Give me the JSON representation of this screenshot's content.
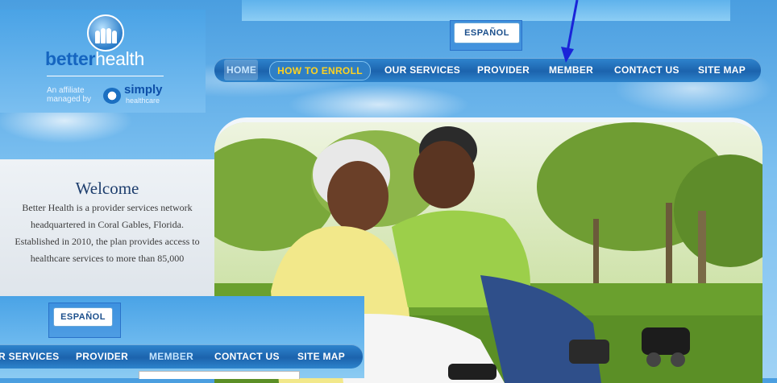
{
  "logo": {
    "brand_strong": "better",
    "brand_light": "health",
    "affiliate_line1": "An affiliate",
    "affiliate_line2": "managed by",
    "partner_name": "simply",
    "partner_sub": "healthcare"
  },
  "language_button": "ESPAÑOL",
  "nav": {
    "home": "HOME",
    "how_to_enroll": "HOW TO ENROLL",
    "our_services": "OUR SERVICES",
    "provider": "PROVIDER",
    "member": "MEMBER",
    "contact_us": "CONTACT US",
    "site_map": "SITE MAP"
  },
  "inset_nav": {
    "services_partial": "R SERVICES",
    "provider": "PROVIDER",
    "member": "MEMBER",
    "contact_us": "CONTACT US",
    "site_map": "SITE MAP"
  },
  "welcome": {
    "title": "Welcome",
    "body": "Better Health is a provider services network headquartered in Coral Gables, Florida. Established in 2010, the plan provides access to healthcare services to more than 85,000"
  },
  "colors": {
    "nav_bar": "#1c63ad",
    "enroll_text": "#ffd21f",
    "annotation_arrow": "#1a24d8",
    "welcome_title": "#1f3f6e"
  },
  "icons": [
    "family-logo-icon",
    "simply-swirl-icon",
    "annotation-arrow-icon"
  ]
}
